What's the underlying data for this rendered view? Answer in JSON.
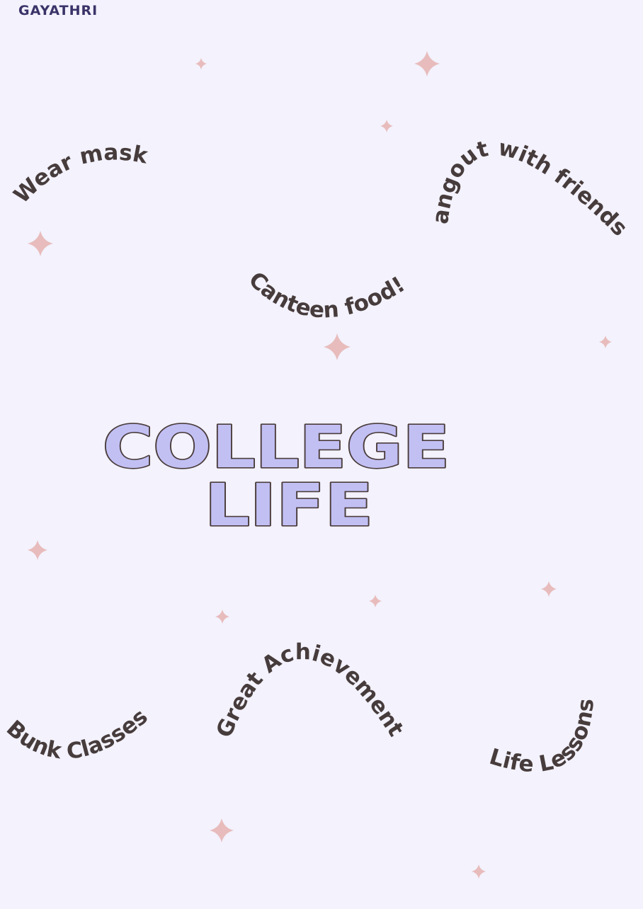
{
  "author": "GAYATHRI",
  "title": {
    "line1": "COLLEGE",
    "line2": "LIFE"
  },
  "phrases": {
    "wear_mask": "Wear mask",
    "hangout": "Hangout with friends!!",
    "canteen": "Canteen food!",
    "bunk": "Bunk Classes",
    "achievements": "Great Achievements",
    "life_lessons": "Life Lessons"
  },
  "colors": {
    "background": "#f3f2fd",
    "title_fill": "#c2c0f3",
    "title_outline": "#4a3c3c",
    "phrase_text": "#473c3c",
    "sparkle": "#e8bcbc",
    "author": "#3a3368"
  },
  "icons": [
    "sparkle-icon"
  ]
}
